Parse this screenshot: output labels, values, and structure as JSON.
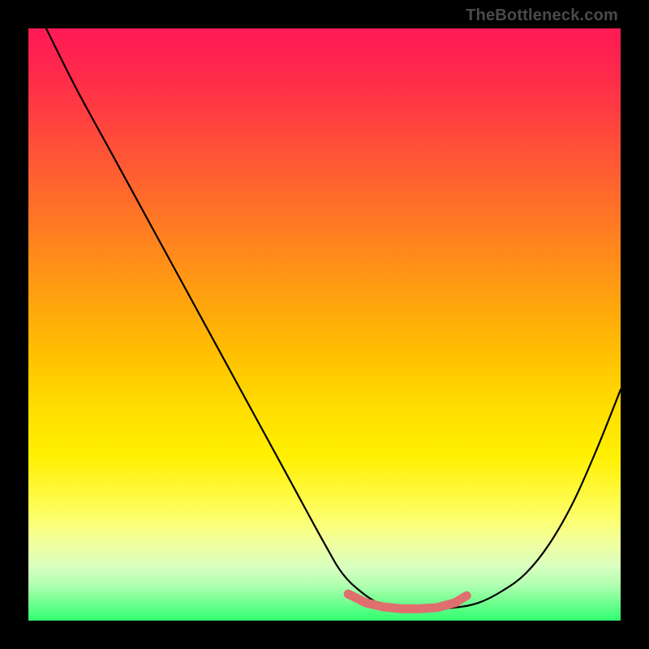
{
  "watermark": "TheBottleneck.com",
  "chart_data": {
    "type": "line",
    "title": "",
    "xlabel": "",
    "ylabel": "",
    "xlim": [
      0,
      100
    ],
    "ylim": [
      0,
      100
    ],
    "background_gradient": {
      "top": "#ff1a55",
      "bottom": "#30ff70",
      "meaning": "red = high bottleneck, green = low bottleneck"
    },
    "series": [
      {
        "name": "bottleneck-curve",
        "color": "#000000",
        "x": [
          3,
          8,
          14,
          20,
          26,
          32,
          38,
          44,
          50,
          53,
          56,
          59,
          62,
          65,
          68,
          72,
          76,
          80,
          84,
          88,
          92,
          96,
          100
        ],
        "y": [
          100,
          90,
          79,
          68,
          57,
          46,
          35,
          24,
          13,
          8,
          5,
          3,
          2.2,
          2,
          2,
          2.2,
          3,
          5,
          8,
          13,
          20,
          29,
          39
        ]
      },
      {
        "name": "optimal-range-marker",
        "color": "#e07070",
        "stroke_width_px": 10,
        "x": [
          54,
          57,
          60,
          63,
          66,
          69,
          72,
          74
        ],
        "y": [
          4.5,
          3,
          2.3,
          2,
          2,
          2.2,
          3,
          4.2
        ]
      }
    ],
    "optimal_x_range": [
      54,
      74
    ]
  }
}
